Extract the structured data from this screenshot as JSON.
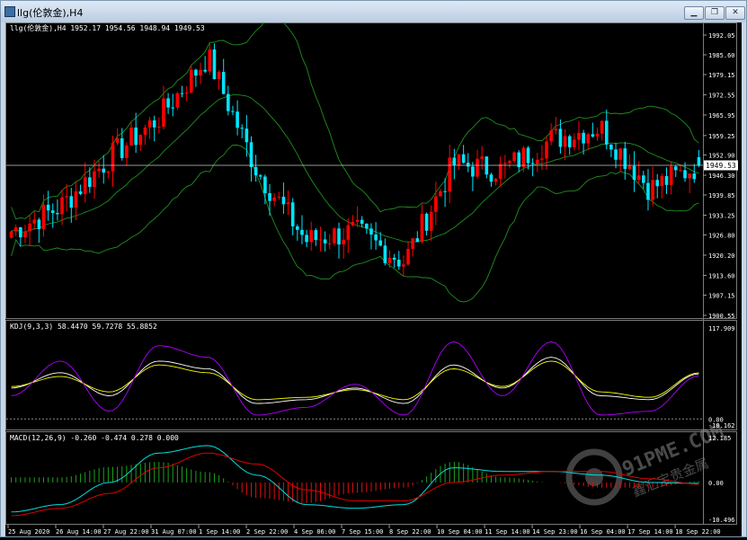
{
  "window": {
    "title": "llg(伦敦金),H4",
    "minimize_label": "▁",
    "restore_label": "❐",
    "close_label": "✕"
  },
  "price_panel": {
    "header": "llg(伦敦金),H4  1952.17 1954.56 1948.94 1949.53",
    "current_price": "1949.53",
    "axis_labels": [
      "1992.05",
      "1985.60",
      "1979.15",
      "1972.55",
      "1965.95",
      "1959.25",
      "1952.90",
      "1946.30",
      "1939.85",
      "1933.25",
      "1926.80",
      "1920.20",
      "1913.60",
      "1907.15",
      "1900.55"
    ]
  },
  "kdj_panel": {
    "header": "KDJ(9,3,3) 58.4470 59.7278 55.8852",
    "axis_labels": [
      "117.909",
      "0.00",
      "-10.162"
    ]
  },
  "macd_panel": {
    "header": "MACD(12,26,9) -0.260 -0.474 0.278 0.000",
    "axis_labels": [
      "12.185",
      "0.00",
      "-10.496"
    ]
  },
  "time_axis": [
    "25 Aug 2020",
    "26 Aug 14:00",
    "27 Aug 22:00",
    "31 Aug 07:00",
    "1 Sep 14:00",
    "2 Sep 22:00",
    "4 Sep 06:00",
    "7 Sep 15:00",
    "8 Sep 22:00",
    "10 Sep 04:00",
    "11 Sep 14:00",
    "14 Sep 23:00",
    "16 Sep 04:00",
    "17 Sep 14:00",
    "18 Sep 22:00"
  ],
  "watermark": {
    "brand": "91PME.COM",
    "subtitle": "鑫汇宝贵金属"
  },
  "colors": {
    "up_candle": "#ff0000",
    "down_candle": "#00e5ff",
    "bollinger": "#1f8f1f",
    "kdj_k": "#ffffff",
    "kdj_d": "#ffff00",
    "kdj_j": "#b000ff",
    "macd_fast": "#00e0e0",
    "macd_slow": "#e00000",
    "macd_hist_pos": "#1aa31a",
    "macd_hist_neg": "#e01010"
  },
  "chart_data": [
    {
      "type": "candlestick",
      "title": "llg(伦敦金),H4",
      "ylim": [
        1900.55,
        1992.05
      ],
      "x": [
        "25 Aug 2020",
        "26 Aug 14:00",
        "27 Aug 22:00",
        "31 Aug 07:00",
        "1 Sep 14:00",
        "2 Sep 22:00",
        "4 Sep 06:00",
        "7 Sep 15:00",
        "8 Sep 22:00",
        "10 Sep 04:00",
        "11 Sep 14:00",
        "14 Sep 23:00",
        "16 Sep 04:00",
        "17 Sep 14:00",
        "18 Sep 22:00"
      ],
      "close": [
        1928,
        1936,
        1952,
        1965,
        1985,
        1948,
        1925,
        1928,
        1918,
        1950,
        1948,
        1958,
        1962,
        1942,
        1949.53
      ],
      "last": {
        "open": 1952.17,
        "high": 1954.56,
        "low": 1948.94,
        "close": 1949.53
      }
    },
    {
      "type": "line",
      "title": "KDJ(9,3,3)",
      "ylim": [
        -10.162,
        117.909
      ],
      "series": [
        {
          "name": "K",
          "values": [
            40,
            60,
            30,
            75,
            65,
            20,
            25,
            40,
            20,
            70,
            40,
            80,
            30,
            25,
            58.447
          ]
        },
        {
          "name": "D",
          "values": [
            42,
            55,
            35,
            70,
            60,
            25,
            28,
            38,
            25,
            65,
            42,
            75,
            35,
            28,
            59.7278
          ]
        },
        {
          "name": "J",
          "values": [
            30,
            75,
            10,
            95,
            80,
            5,
            15,
            45,
            5,
            100,
            30,
            100,
            5,
            10,
            55.8852
          ]
        }
      ]
    },
    {
      "type": "bar",
      "title": "MACD(12,26,9)",
      "ylim": [
        -10.496,
        12.185
      ],
      "series": [
        {
          "name": "MACD",
          "values": [
            -8,
            -6,
            0,
            8,
            10,
            2,
            -6,
            -7,
            -6,
            4,
            3,
            3,
            2,
            0,
            -0.26
          ]
        },
        {
          "name": "Signal",
          "values": [
            -9,
            -7,
            -3,
            4,
            8,
            5,
            -2,
            -5,
            -5,
            0,
            2,
            3,
            3,
            1,
            -0.474
          ]
        }
      ]
    }
  ]
}
